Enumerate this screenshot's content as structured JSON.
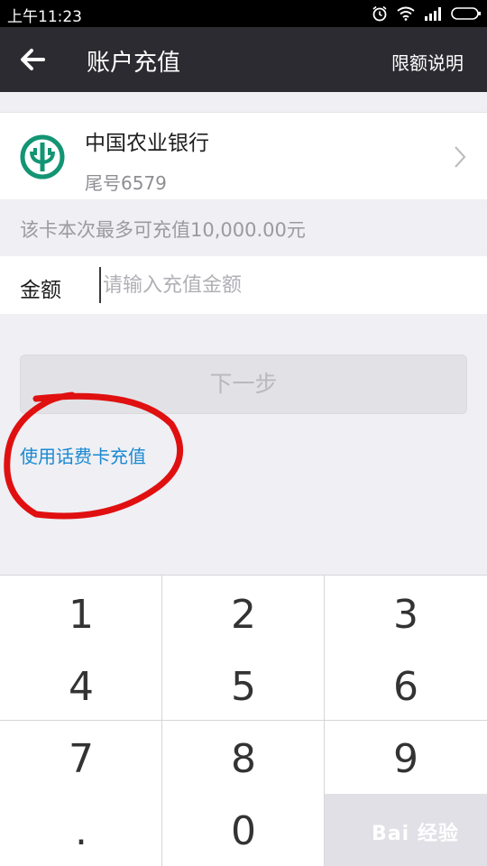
{
  "status_bar": {
    "time": "上午11:23",
    "icons": [
      "alarm-icon",
      "wifi-icon",
      "signal-icon",
      "battery-icon"
    ]
  },
  "nav": {
    "title": "账户充值",
    "right_link": "限额说明"
  },
  "bank": {
    "name": "中国农业银行",
    "tail": "尾号6579",
    "logo_color": "#139574"
  },
  "limit_text": "该卡本次最多可充值10,000.00元",
  "amount": {
    "label": "金额",
    "placeholder": "请输入充值金额",
    "value": ""
  },
  "next_button": "下一步",
  "phone_card_link": "使用话费卡充值",
  "keypad": {
    "keys": [
      "1",
      "2",
      "3",
      "4",
      "5",
      "6",
      "7",
      "8",
      "9",
      ".",
      "0"
    ]
  },
  "watermark": "Bai 经验",
  "colors": {
    "nav_bg": "#2b2b31",
    "link": "#1a8ad1",
    "annotation": "#e01010"
  }
}
